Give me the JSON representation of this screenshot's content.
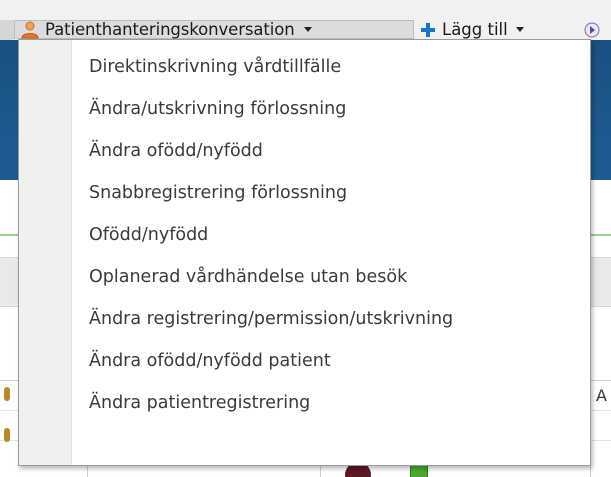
{
  "toolbar": {
    "conversation_label": "Patienthanteringskonversation",
    "add_label": "Lägg till",
    "icons": {
      "conversation": "person-icon",
      "add": "plus-icon",
      "more": "more-icon"
    }
  },
  "grid": {
    "header_fragment": "A"
  },
  "menu": {
    "items": [
      {
        "label": "Direktinskrivning vårdtillfälle"
      },
      {
        "label": "Ändra/utskrivning förlossning"
      },
      {
        "label": "Ändra ofödd/nyfödd"
      },
      {
        "label": "Snabbregistrering förlossning"
      },
      {
        "label": "Ofödd/nyfödd"
      },
      {
        "label": "Oplanerad vårdhändelse utan besök"
      },
      {
        "label": "Ändra registrering/permission/utskrivning"
      },
      {
        "label": "Ändra ofödd/nyfödd patient"
      },
      {
        "label": "Ändra patientregistrering"
      }
    ]
  },
  "colors": {
    "header_band": "#1d5a92",
    "accent_plus": "#1a74c9",
    "menu_text": "#3a3a3a"
  }
}
